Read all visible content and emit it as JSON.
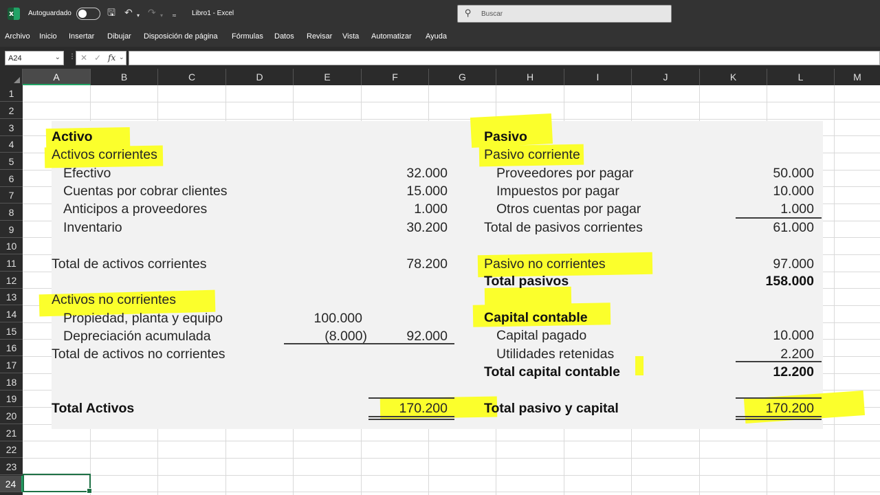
{
  "titlebar": {
    "autosave_label": "Autoguardado",
    "doc_title": "Libro1  -  Excel",
    "search_placeholder": "Buscar"
  },
  "menu": [
    "Archivo",
    "Inicio",
    "Insertar",
    "Dibujar",
    "Disposición de página",
    "Fórmulas",
    "Datos",
    "Revisar",
    "Vista",
    "Automatizar",
    "Ayuda"
  ],
  "formula_bar": {
    "name_box": "A24",
    "fx": "fx",
    "content": ""
  },
  "columns": [
    "A",
    "B",
    "C",
    "D",
    "E",
    "F",
    "G",
    "H",
    "I",
    "J",
    "K",
    "L",
    "M"
  ],
  "rows": [
    "1",
    "2",
    "3",
    "4",
    "5",
    "6",
    "7",
    "8",
    "9",
    "10",
    "11",
    "12",
    "13",
    "14",
    "15",
    "16",
    "17",
    "18",
    "19",
    "20",
    "21",
    "22",
    "23",
    "24"
  ],
  "active_cell": {
    "column": "A",
    "row": "24"
  },
  "balance_sheet": {
    "left": {
      "heading": "Activo",
      "current_heading": "Activos corrientes",
      "cash_label": "Efectivo",
      "cash_value": "32.000",
      "receivables_label": "Cuentas por cobrar clientes",
      "receivables_value": "15.000",
      "advances_label": "Anticipos a proveedores",
      "advances_value": "1.000",
      "inventory_label": "Inventario",
      "inventory_value": "30.200",
      "total_current_label": "Total de activos corrientes",
      "total_current_value": "78.200",
      "noncurrent_heading": "Activos no corrientes",
      "ppe_label": "Propiedad, planta y equipo",
      "ppe_value": "100.000",
      "depreciation_label": "Depreciación acumulada",
      "depreciation_value": "(8.000)",
      "net_ppe_value": "92.000",
      "total_noncurrent_label": "Total de activos no corrientes",
      "total_assets_label": "Total Activos",
      "total_assets_value": "170.200"
    },
    "right": {
      "heading": "Pasivo",
      "current_heading": "Pasivo corriente",
      "suppliers_label": "Proveedores por pagar",
      "suppliers_value": "50.000",
      "taxes_label": "Impuestos por pagar",
      "taxes_value": "10.000",
      "other_label": "Otros cuentas por pagar",
      "other_value": "1.000",
      "total_current_label": "Total de pasivos corrientes",
      "total_current_value": "61.000",
      "noncurrent_label": "Pasivo no corrientes",
      "noncurrent_value": "97.000",
      "total_liabilities_label": "Total pasivos",
      "total_liabilities_value": "158.000",
      "equity_heading": "Capital contable",
      "paid_in_label": "Capital pagado",
      "paid_in_value": "10.000",
      "retained_label": "Utilidades retenidas",
      "retained_value": "2.200",
      "total_equity_label": "Total capital contable",
      "total_equity_value": "12.200",
      "total_le_label": "Total pasivo y capital",
      "total_le_value": "170.200"
    }
  },
  "colors": {
    "title_bar": "#333333",
    "highlight": "#fbff2c",
    "selection": "#1e7145",
    "image_background": "#f2f2f2"
  },
  "icons": [
    "excel-logo-icon",
    "save-icon",
    "undo-icon",
    "redo-icon",
    "customize-icon",
    "search-icon",
    "chevron-down-icon",
    "cancel-icon",
    "enter-icon",
    "fx-icon"
  ]
}
